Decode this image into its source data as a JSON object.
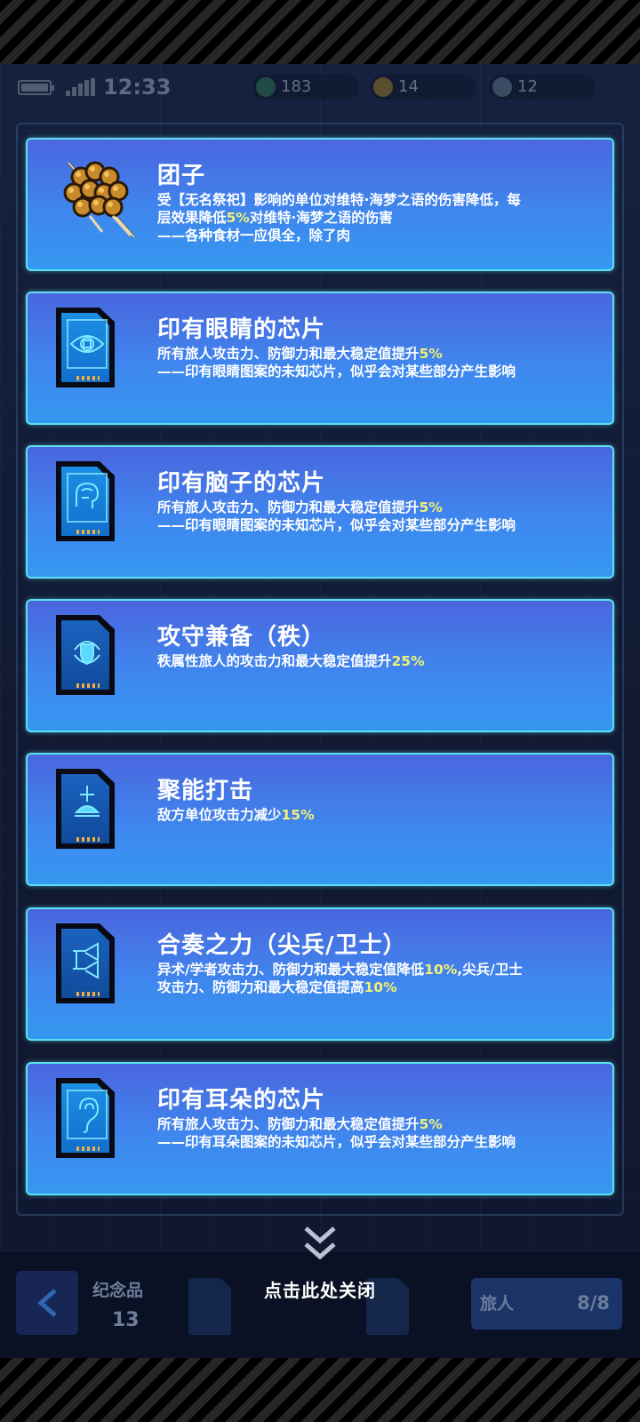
{
  "status_bar": {
    "time": "12:33"
  },
  "resources": [
    {
      "name": "green-currency",
      "value": "183",
      "color": "#2f7d4f"
    },
    {
      "name": "gold-currency",
      "value": "14",
      "color": "#b0841f"
    },
    {
      "name": "silver-currency",
      "value": "12",
      "color": "#6b7f8f"
    }
  ],
  "cards": [
    {
      "icon": "dango-icon",
      "title": "团子",
      "desc": [
        [
          {
            "t": "受【无名祭祀】影响的单位对维特·海梦之语的伤害降低，每"
          }
        ],
        [
          {
            "t": "层效果降低"
          },
          {
            "t": "5%",
            "hl": true
          },
          {
            "t": "对维特·海梦之语的伤害"
          }
        ],
        [
          {
            "t": "——各种食材一应俱全，除了肉"
          }
        ]
      ]
    },
    {
      "icon": "eye-chip-icon",
      "title": "印有眼睛的芯片",
      "desc": [
        [
          {
            "t": "所有旅人攻击力、防御力和最大稳定值提升"
          },
          {
            "t": "5%",
            "hl": true
          }
        ],
        [
          {
            "t": "——印有眼睛图案的未知芯片，似乎会对某些部分产生影响"
          }
        ]
      ]
    },
    {
      "icon": "brain-chip-icon",
      "title": "印有脑子的芯片",
      "desc": [
        [
          {
            "t": "所有旅人攻击力、防御力和最大稳定值提升"
          },
          {
            "t": "5%",
            "hl": true
          }
        ],
        [
          {
            "t": "——印有眼睛图案的未知芯片，似乎会对某些部分产生影响"
          }
        ]
      ]
    },
    {
      "icon": "shield-chip-icon",
      "title": "攻守兼备（秩）",
      "desc": [
        [
          {
            "t": "秩属性旅人的攻击力和最大稳定值提升"
          },
          {
            "t": "25%",
            "hl": true
          }
        ]
      ]
    },
    {
      "icon": "focus-strike-chip-icon",
      "title": "聚能打击",
      "desc": [
        [
          {
            "t": "敌方单位攻击力减少"
          },
          {
            "t": "15%",
            "hl": true
          }
        ]
      ]
    },
    {
      "icon": "trumpet-chip-icon",
      "title": "合奏之力（尖兵/卫士）",
      "desc": [
        [
          {
            "t": "异术/学者攻击力、防御力和最大稳定值降低"
          },
          {
            "t": "10%",
            "hl": true
          },
          {
            "t": ",尖兵/卫士"
          }
        ],
        [
          {
            "t": "攻击力、防御力和最大稳定值提高"
          },
          {
            "t": "10%",
            "hl": true
          }
        ]
      ]
    },
    {
      "icon": "ear-chip-icon",
      "title": "印有耳朵的芯片",
      "desc": [
        [
          {
            "t": "所有旅人攻击力、防御力和最大稳定值提升"
          },
          {
            "t": "5%",
            "hl": true
          }
        ],
        [
          {
            "t": "——印有耳朵图案的未知芯片，似乎会对某些部分产生影响"
          }
        ]
      ]
    }
  ],
  "close": {
    "label": "点击此处关闭"
  },
  "bottom_bar": {
    "souvenir_label": "纪念品",
    "souvenir_count": "13",
    "traveler_label": "旅人",
    "traveler_count": "8/8"
  },
  "colors": {
    "highlight": "#f3f173",
    "card_border": "#5ee0f2",
    "card_top": "#4a66de",
    "card_bottom": "#3598f0"
  }
}
